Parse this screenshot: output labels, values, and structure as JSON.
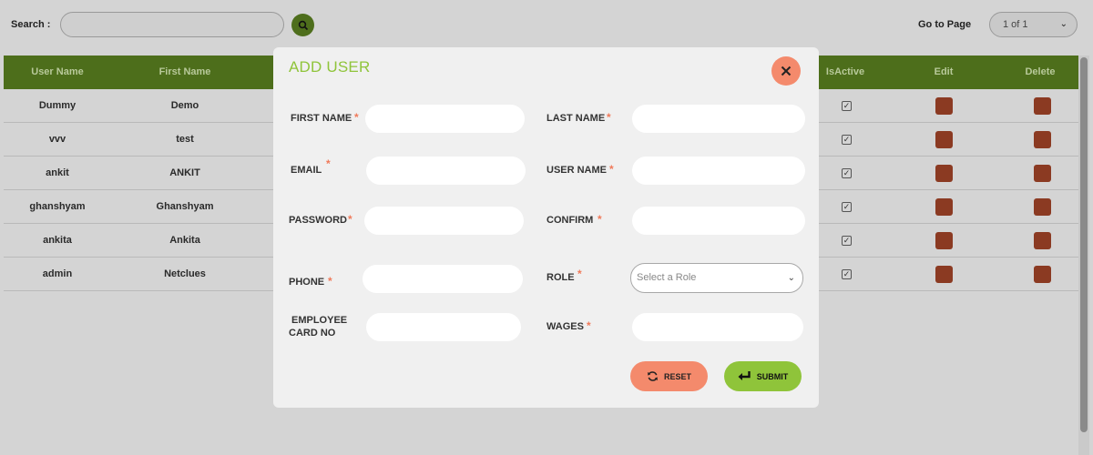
{
  "topbar": {
    "search_label": "Search :",
    "goto_label": "Go to Page",
    "page_value": "1 of 1"
  },
  "table": {
    "columns": [
      "User Name",
      "First Name",
      "IsActive",
      "Edit",
      "Delete"
    ],
    "rows": [
      {
        "user_name": "Dummy",
        "first_name": "Demo"
      },
      {
        "user_name": "vvv",
        "first_name": "test"
      },
      {
        "user_name": "ankit",
        "first_name": "ANKIT"
      },
      {
        "user_name": "ghanshyam",
        "first_name": "Ghanshyam"
      },
      {
        "user_name": "ankita",
        "first_name": "Ankita"
      },
      {
        "user_name": "admin",
        "first_name": "Netclues"
      }
    ]
  },
  "modal": {
    "title": "ADD USER",
    "fields": {
      "first_name": "FIRST NAME",
      "last_name": "LAST NAME",
      "email": "EMAIL",
      "user_name": "USER NAME",
      "password": "PASSWORD",
      "confirm": "CONFIRM",
      "phone": "PHONE",
      "role": "ROLE",
      "employee_card_line1": "EMPLOYEE",
      "employee_card_line2": "CARD NO",
      "wages": "WAGES"
    },
    "required_mark": "*",
    "role_placeholder": "Select a Role",
    "reset_label": "RESET",
    "submit_label": "SUBMIT"
  },
  "colors": {
    "accent_green": "#8fc43a",
    "accent_orange": "#f48a6c",
    "header_green": "#4d6e1b"
  },
  "icons": [
    "search-icon",
    "chevron-down-icon",
    "close-icon",
    "checkbox-icon",
    "edit-icon",
    "trash-icon",
    "refresh-icon",
    "enter-icon"
  ]
}
